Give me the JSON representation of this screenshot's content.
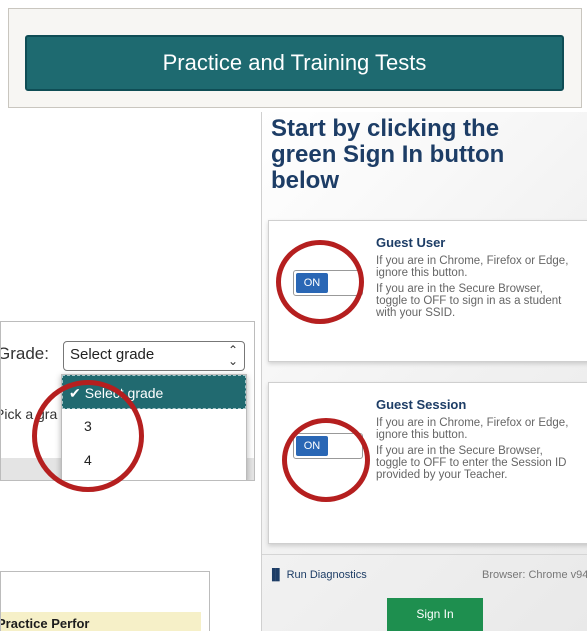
{
  "top": {
    "button_label": "Practice and Training Tests"
  },
  "grade": {
    "label": "Grade:",
    "select_value": "Select grade",
    "hint": "Pick a gra",
    "options": [
      "Select grade",
      "3",
      "4"
    ]
  },
  "signin_panel": {
    "heading": "Start by clicking the green Sign In button below",
    "guest_user": {
      "title": "Guest User",
      "text1": "If you are in Chrome, Firefox or Edge, ignore this button.",
      "text2": "If you are in the Secure Browser, toggle to OFF to sign in as a student with your SSID.",
      "toggle": "ON"
    },
    "guest_session": {
      "title": "Guest Session",
      "text1": "If you are in Chrome, Firefox or Edge, ignore this button.",
      "text2": "If you are in the Secure Browser, toggle to OFF to enter the Session ID provided by your Teacher.",
      "toggle": "ON"
    },
    "diagnostics": "Run Diagnostics",
    "browser": "Browser: Chrome v94",
    "signin_label": "Sign In"
  },
  "bottom": {
    "label": "Practice Perfor"
  },
  "colors": {
    "teal": "#1e6a70",
    "navy": "#1d3d66",
    "green": "#1e8f4f",
    "annotation_red": "#b51f1f",
    "toggle_blue": "#2a67b5"
  }
}
